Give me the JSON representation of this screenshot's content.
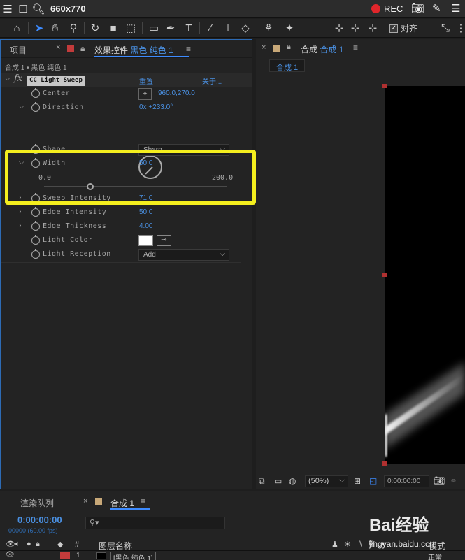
{
  "window": {
    "title": "660x770",
    "rec_label": "REC"
  },
  "toolbar": {
    "snap_label": "对齐"
  },
  "left_panel": {
    "tab_project": "项目",
    "tab_effects_prefix": "效果控件",
    "tab_effects_layer": "黑色 纯色 1",
    "breadcrumb": "合成 1 • 黑色 纯色 1",
    "effect_name": "CC Light Sweep",
    "reset_label": "重置",
    "about_label": "关于...",
    "props": {
      "center_label": "Center",
      "center_value": "960.0,270.0",
      "direction_label": "Direction",
      "direction_value": "0x +233.0°",
      "shape_label": "Shape",
      "shape_value": "Sharp",
      "width_label": "Width",
      "width_value": "50.0",
      "width_min": "0.0",
      "width_max": "200.0",
      "width_slider_fraction": 0.25,
      "sweep_label": "Sweep Intensity",
      "sweep_value": "71.0",
      "edge_int_label": "Edge Intensity",
      "edge_int_value": "50.0",
      "edge_thick_label": "Edge Thickness",
      "edge_thick_value": "4.00",
      "light_color_label": "Light Color",
      "light_color": "#ffffff",
      "light_reception_label": "Light Reception",
      "light_reception_value": "Add"
    }
  },
  "right_panel": {
    "tab_prefix": "合成",
    "tab_name": "合成 1",
    "subtab": "合成 1",
    "zoom": "(50%)",
    "timecode": "0:00:00:00"
  },
  "bottom": {
    "tab_render": "渲染队列",
    "tab_comp": "合成 1",
    "timecode": "0:00:00:00",
    "fps": "00000 (60.00 fps)",
    "col_hash": "#",
    "col_layer_name": "图层名称",
    "col_mode": "模式",
    "layer_num": "1",
    "layer_name": "[黑色 纯色 1]",
    "layer_mode": "正常",
    "watermark": "Bai经验",
    "watermark_url": "jingyan.baidu.com"
  },
  "colors": {
    "accent": "#4a90e2",
    "highlight": "#f4ee1e",
    "rec": "#e0262b"
  }
}
